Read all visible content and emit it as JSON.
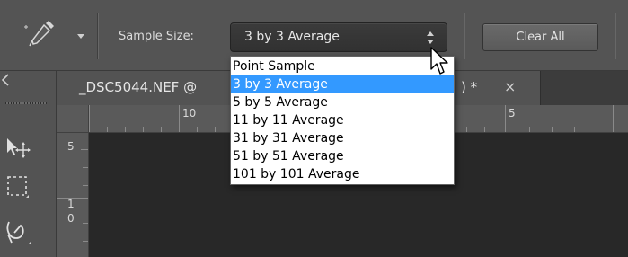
{
  "options_bar": {
    "tool_preset_icon": "eyedropper-icon",
    "tool_preset_dropdown_icon": "chevron-down-icon",
    "sample_size_label": "Sample Size:",
    "sample_size_value": "3 by 3 Average",
    "select_arrows_icon": "up-down-arrows-icon",
    "clear_all_label": "Clear All"
  },
  "sample_size_dropdown": {
    "options": [
      "Point Sample",
      "3 by 3 Average",
      "5 by 5 Average",
      "11 by 11 Average",
      "31 by 31 Average",
      "51 by 51 Average",
      "101 by 101 Average"
    ],
    "selected": "3 by 3 Average",
    "highlight_color": "#3399ff"
  },
  "document_tab": {
    "title_visible": "_DSC5044.NEF @",
    "title_suffix_visible": ") *",
    "close_label": "×"
  },
  "rulers": {
    "top_labels": [
      "10",
      "5"
    ],
    "left_labels": [
      "5",
      "1",
      "0"
    ]
  },
  "toolbar": {
    "tools": [
      "move-tool-icon",
      "marquee-tool-icon",
      "lasso-tool-icon"
    ]
  },
  "colors": {
    "options_bar": "#545454",
    "canvas_background": "#282828",
    "dropdown_background": "#ffffff",
    "selected_option": "#3399ff"
  }
}
